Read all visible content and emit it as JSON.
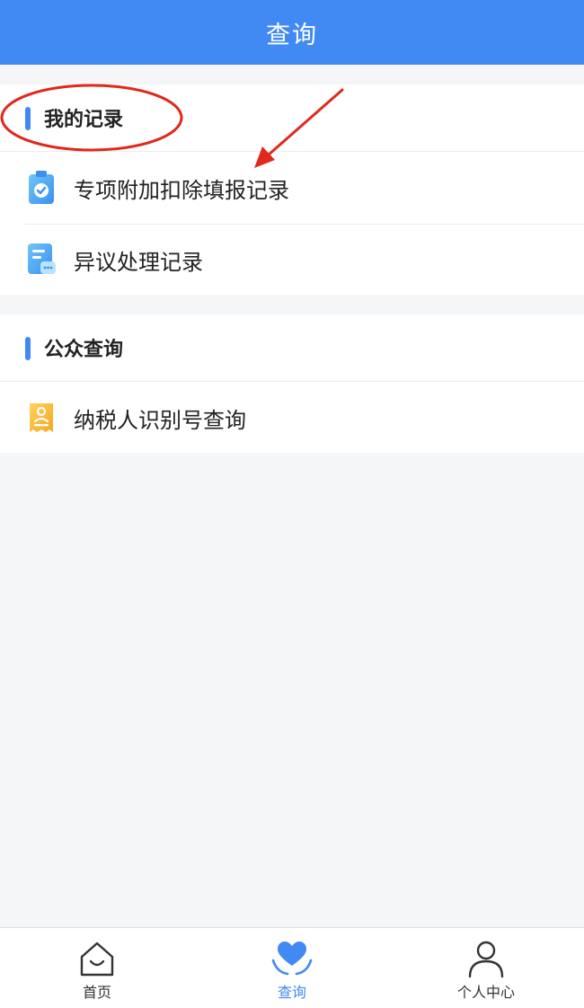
{
  "header": {
    "title": "查询"
  },
  "sections": [
    {
      "title": "我的记录",
      "items": [
        {
          "label": "专项附加扣除填报记录",
          "icon": "clipboard-check-icon"
        },
        {
          "label": "异议处理记录",
          "icon": "document-chat-icon"
        }
      ]
    },
    {
      "title": "公众查询",
      "items": [
        {
          "label": "纳税人识别号查询",
          "icon": "id-badge-icon"
        }
      ]
    }
  ],
  "tabs": [
    {
      "label": "首页",
      "icon": "home-icon",
      "active": false
    },
    {
      "label": "查询",
      "icon": "heart-hands-icon",
      "active": true
    },
    {
      "label": "个人中心",
      "icon": "person-icon",
      "active": false
    }
  ],
  "colors": {
    "accent": "#4189f3",
    "annotation": "#e0281e",
    "background": "#f5f6f8"
  }
}
